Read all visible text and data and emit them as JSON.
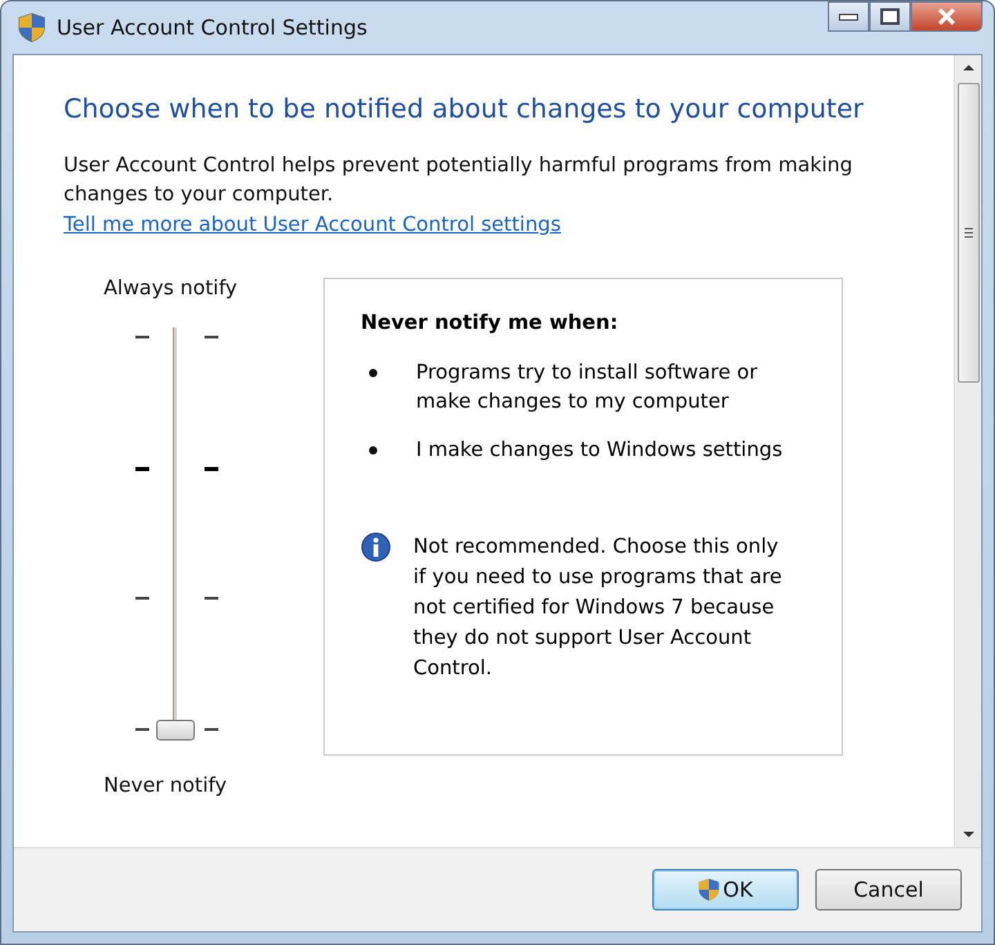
{
  "window": {
    "title": "User Account Control Settings"
  },
  "heading": "Choose when to be notified about changes to your computer",
  "description": "User Account Control helps prevent potentially harmful programs from making changes to your computer.",
  "link": "Tell me more about User Account Control settings",
  "slider": {
    "top_label": "Always notify",
    "bottom_label": "Never notify",
    "level": 0
  },
  "info_panel": {
    "title": "Never notify me when:",
    "bullets": [
      "Programs try to install software or make changes to my computer",
      "I make changes to Windows settings"
    ],
    "note": "Not recommended. Choose this only if you need to use programs that are not certified for Windows 7 because they do not support User Account Control."
  },
  "buttons": [
    {
      "label": "OK",
      "kind": "default"
    },
    {
      "label": "Cancel",
      "kind": "normal"
    }
  ]
}
